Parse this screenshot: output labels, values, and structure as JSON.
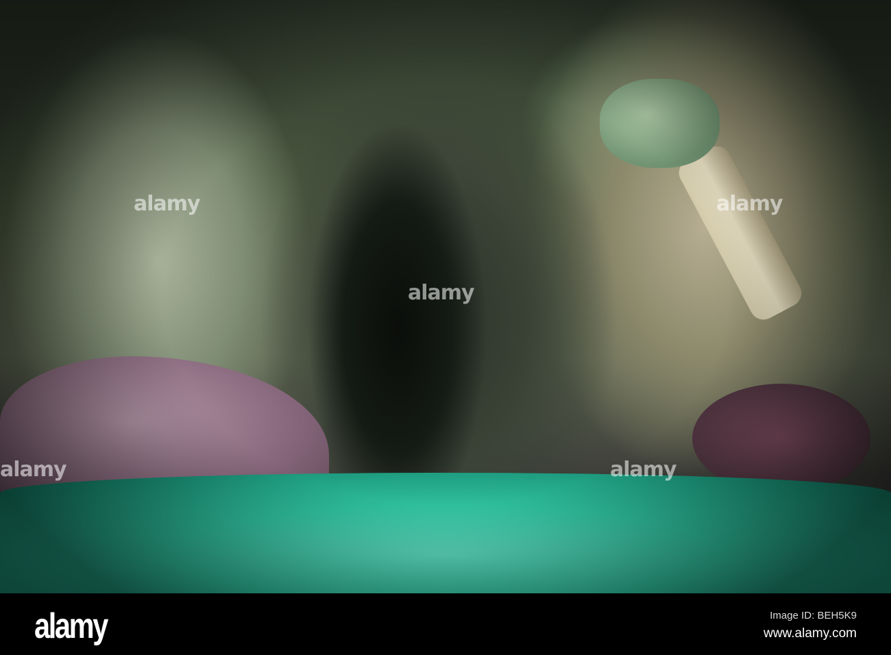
{
  "photo": {
    "subject": "cave",
    "watermark_text": "alamy"
  },
  "footer": {
    "logo": "alamy",
    "image_id": "Image ID: BEH5K9",
    "url": "www.alamy.com"
  }
}
